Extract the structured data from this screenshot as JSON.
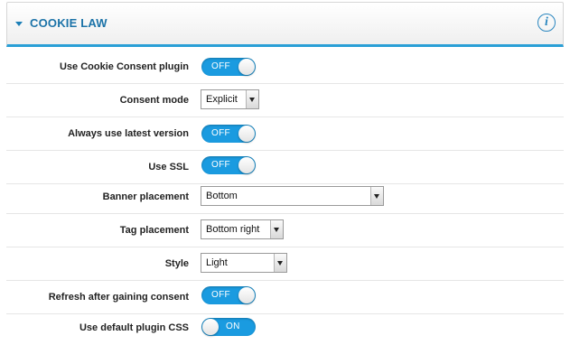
{
  "panel": {
    "title": "COOKIE LAW",
    "info_icon": "info-icon"
  },
  "settings": [
    {
      "label": "Use Cookie Consent plugin",
      "control": "toggle",
      "value": "OFF"
    },
    {
      "label": "Consent mode",
      "control": "select",
      "value": "Explicit"
    },
    {
      "label": "Always use latest version",
      "control": "toggle",
      "value": "OFF"
    },
    {
      "label": "Use SSL",
      "control": "toggle",
      "value": "OFF"
    },
    {
      "label": "Banner placement",
      "control": "select",
      "value": "Bottom"
    },
    {
      "label": "Tag placement",
      "control": "select",
      "value": "Bottom right"
    },
    {
      "label": "Style",
      "control": "select",
      "value": "Light"
    },
    {
      "label": "Refresh after gaining consent",
      "control": "toggle",
      "value": "OFF"
    },
    {
      "label": "Use default plugin CSS",
      "control": "toggle",
      "value": "ON"
    }
  ],
  "colors": {
    "accent": "#1a9be0",
    "title": "#1c73a8",
    "border": "#2a9fd6"
  }
}
